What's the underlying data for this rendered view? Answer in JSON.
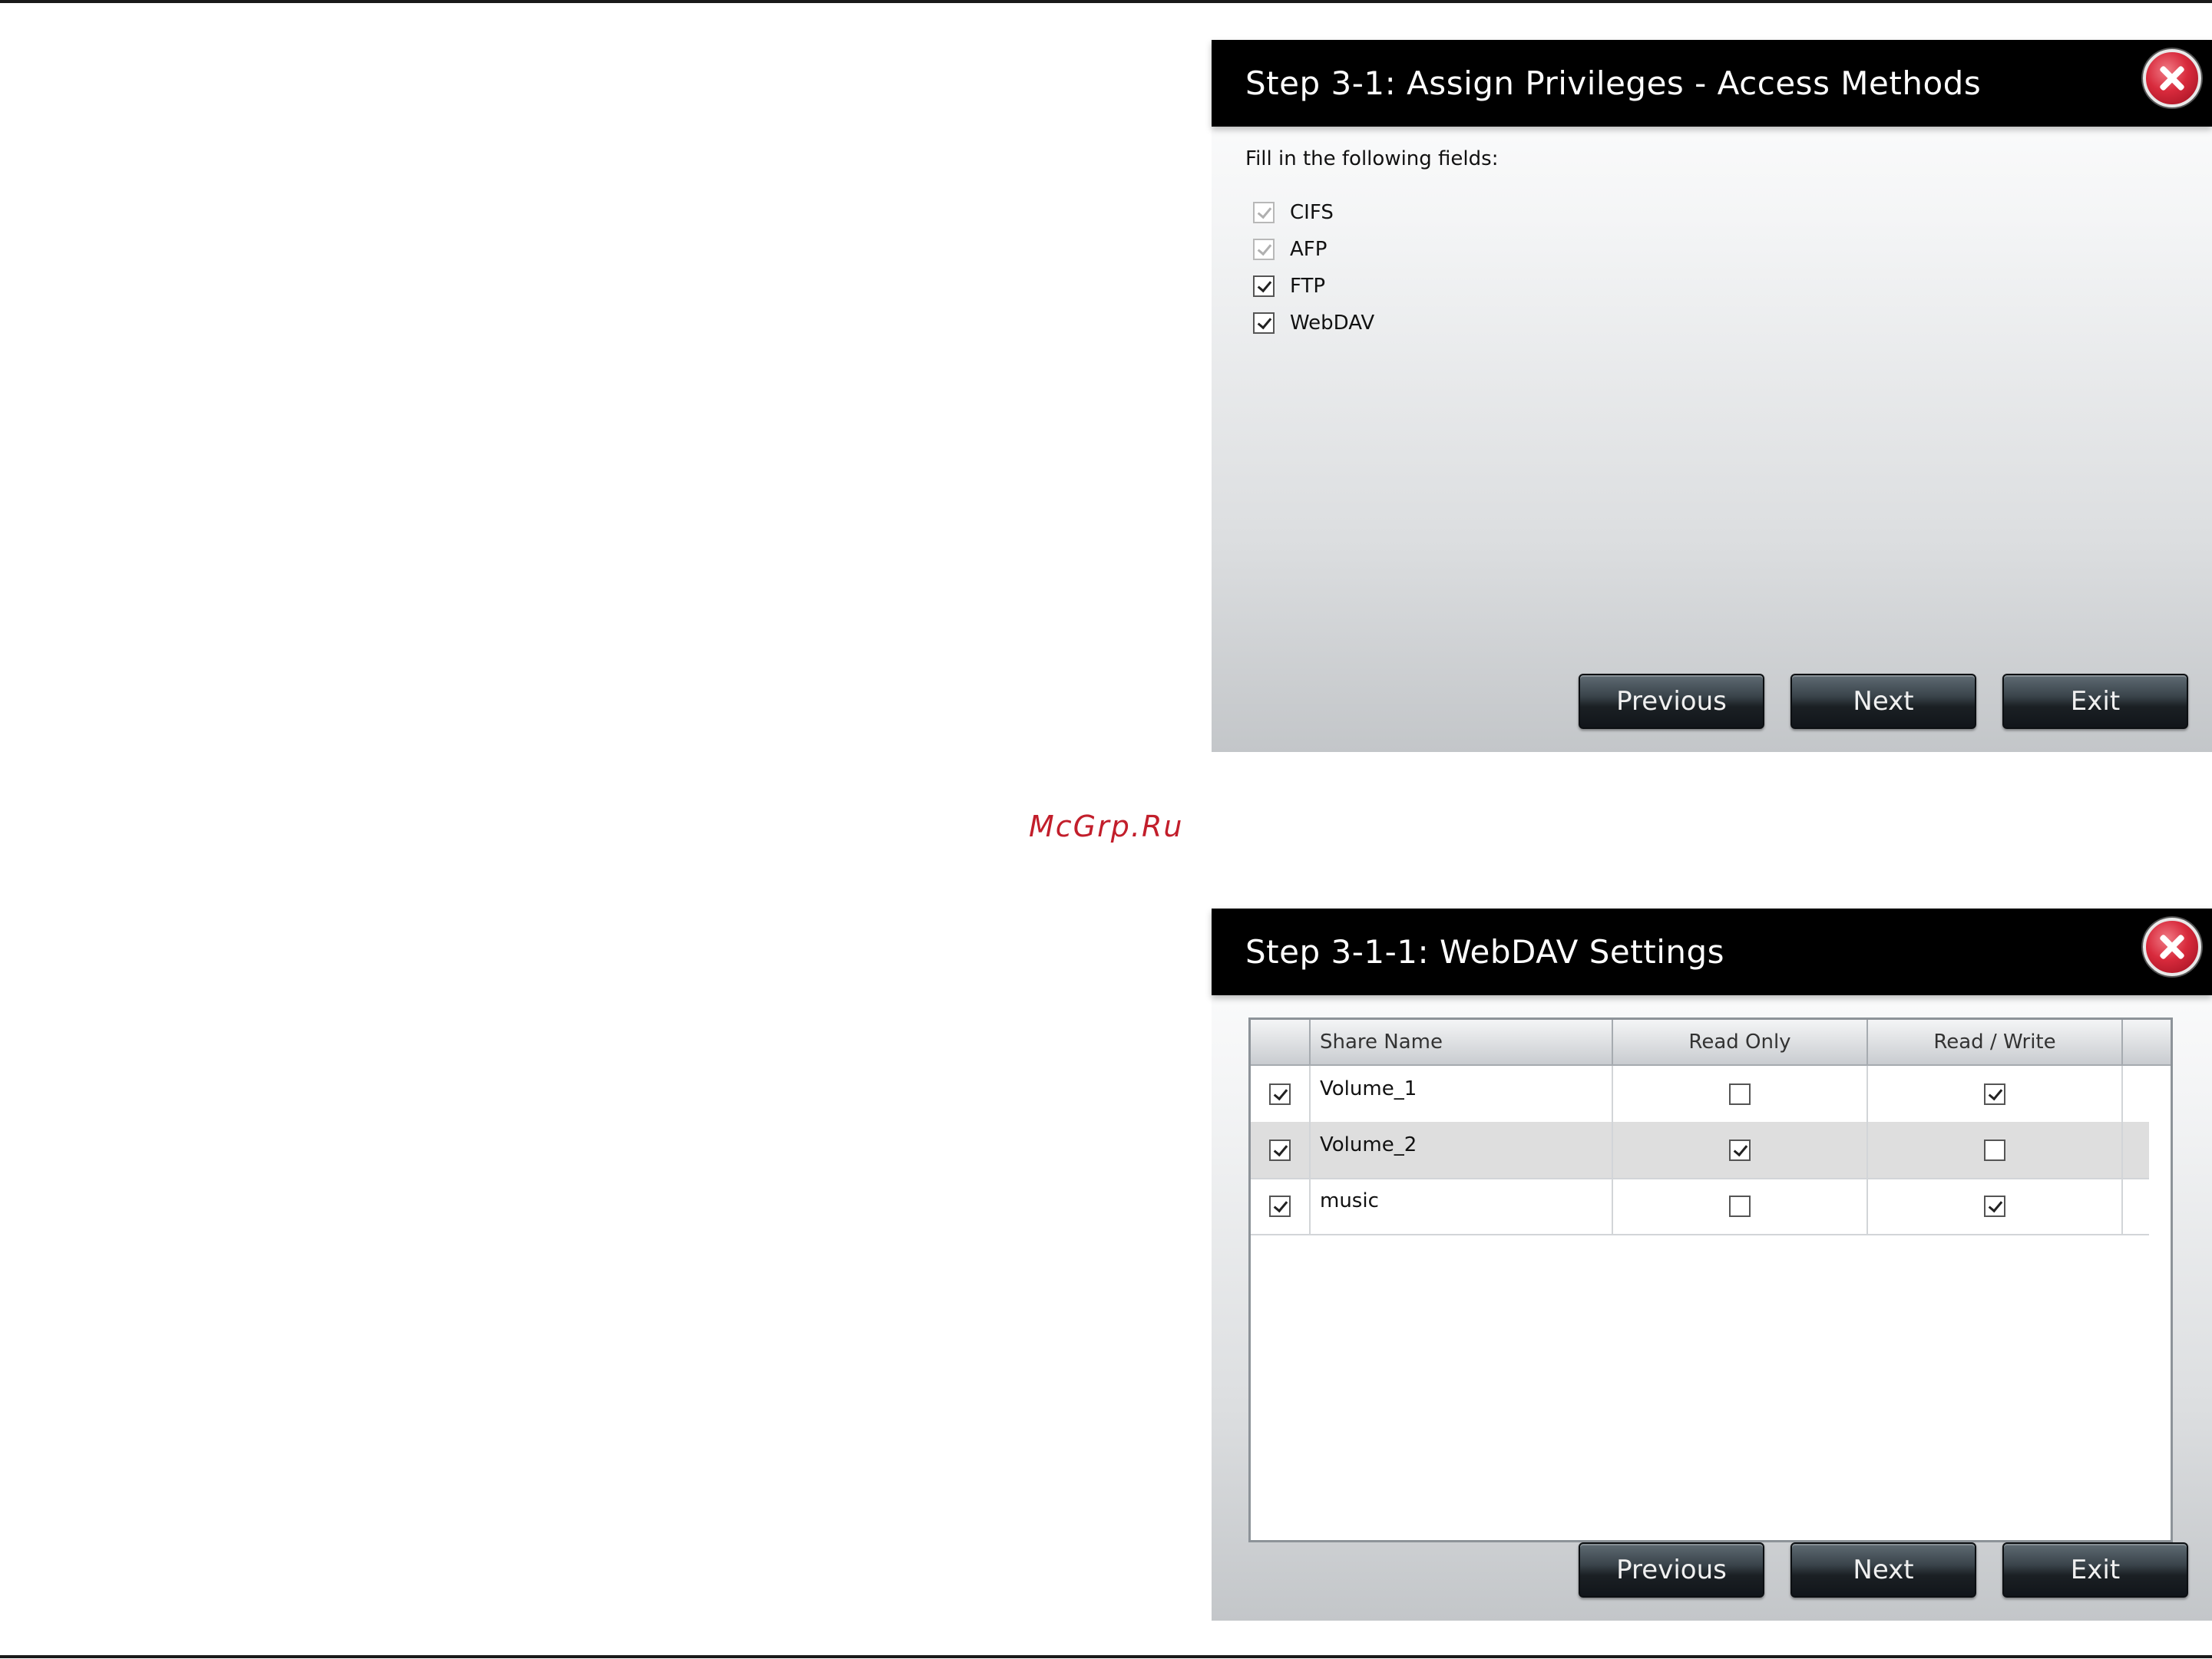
{
  "watermark": "McGrp.Ru",
  "dialog1": {
    "title": "Step 3-1: Assign Privileges - Access Methods",
    "instruction": "Fill in the following fields:",
    "methods": [
      {
        "label": "CIFS",
        "checked": true,
        "disabled": true
      },
      {
        "label": "AFP",
        "checked": true,
        "disabled": true
      },
      {
        "label": "FTP",
        "checked": true,
        "disabled": false
      },
      {
        "label": "WebDAV",
        "checked": true,
        "disabled": false
      }
    ],
    "buttons": {
      "previous": "Previous",
      "next": "Next",
      "exit": "Exit"
    }
  },
  "dialog2": {
    "title": "Step 3-1-1: WebDAV Settings",
    "columns": [
      "",
      "Share Name",
      "Read Only",
      "Read / Write"
    ],
    "rows": [
      {
        "selected": true,
        "share": "Volume_1",
        "read_only": false,
        "read_write": true
      },
      {
        "selected": true,
        "share": "Volume_2",
        "read_only": true,
        "read_write": false
      },
      {
        "selected": true,
        "share": "music",
        "read_only": false,
        "read_write": true
      }
    ],
    "buttons": {
      "previous": "Previous",
      "next": "Next",
      "exit": "Exit"
    }
  },
  "icons": {
    "close": "close-icon",
    "checkbox": "checkbox-icon"
  },
  "colors": {
    "title_bar": "#000000",
    "close_button": "#d82a3c",
    "button": "#2a3238",
    "watermark": "#c21e2b"
  }
}
